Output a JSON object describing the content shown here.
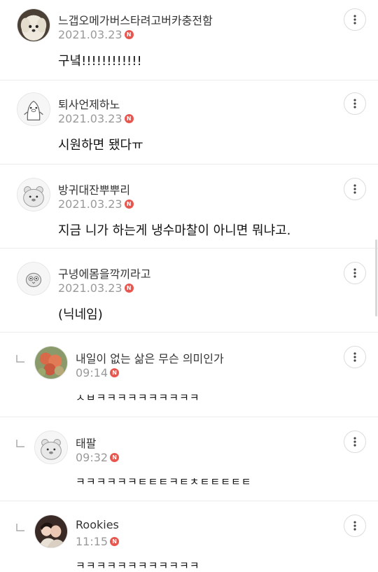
{
  "comments": [
    {
      "name": "느갭오메가버스타려고버카충전함",
      "date": "2021.03.23",
      "new_badge": "N",
      "text": "구녘!!!!!!!!!!!!",
      "avatar": "dog-photo-avatar"
    },
    {
      "name": "퇴사언제하노",
      "date": "2021.03.23",
      "new_badge": "N",
      "text": "시원하면 됐다ㅠ",
      "avatar": "penguin-avatar"
    },
    {
      "name": "방귀대잔뿌뿌리",
      "date": "2021.03.23",
      "new_badge": "N",
      "text": "지금 니가 하는게 냉수마찰이 아니면 뭐냐고.",
      "avatar": "bear-avatar"
    },
    {
      "name": "구녕에몸을깍끼라고",
      "date": "2021.03.23",
      "new_badge": "N",
      "text": "(닉네임)",
      "avatar": "owl-avatar"
    }
  ],
  "replies": [
    {
      "name": "내일이 없는 삶은 무슨 의미인가",
      "date": "09:14",
      "new_badge": "N",
      "text": "ㅅㅂㅋㅋㅋㅋㅋㅋㅋㅋㅋㅋ",
      "avatar": "flower-photo-avatar"
    },
    {
      "name": "태팔",
      "date": "09:32",
      "new_badge": "N",
      "text": "ㅋㅋㅋㅋㅋㅋㅌㅌㅌㅋㅌㅊㅌㅌㅌㅌㅌ",
      "avatar": "bear-avatar"
    },
    {
      "name": "Rookies",
      "date": "11:15",
      "new_badge": "N",
      "text": "ㅋㅋㅋㅋㅋㅋㅋㅋㅋㅋㅋㅋ",
      "avatar": "people-photo-avatar"
    }
  ],
  "icons": {
    "more": "more-vertical-icon",
    "reply": "reply-arrow-icon",
    "badge": "new-badge"
  },
  "colors": {
    "badge": "#e8574f",
    "meta": "#9a9a9a",
    "divider": "#ececec"
  }
}
